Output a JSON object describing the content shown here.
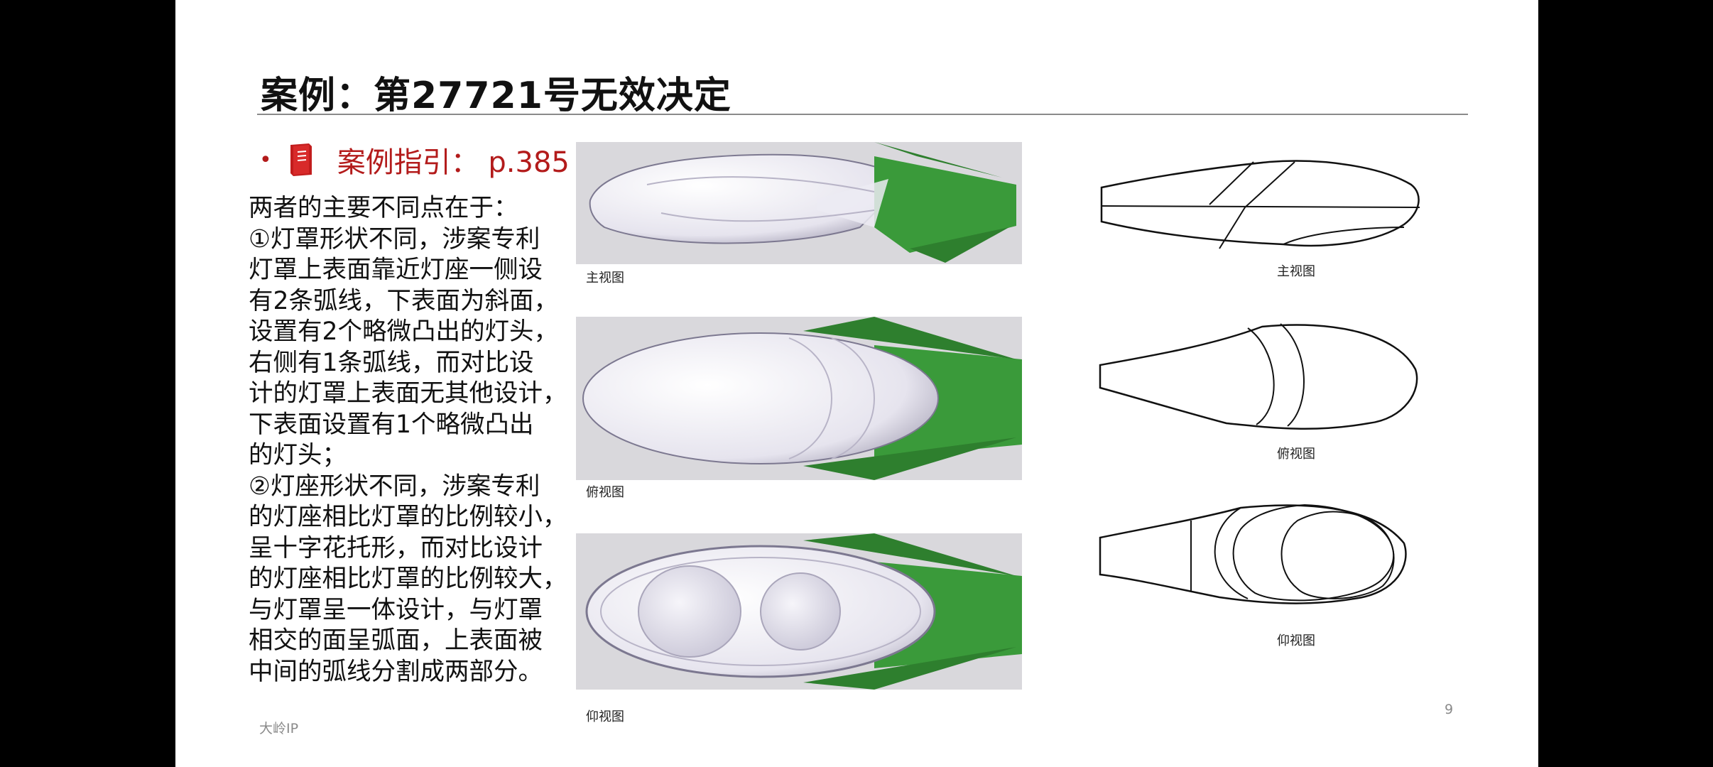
{
  "slide": {
    "title": "案例：第27721号无效决定",
    "guide": {
      "bullet": "•",
      "icon": "book-icon",
      "text": "案例指引： p.385",
      "color": "#b31b1b"
    },
    "body_lines": [
      "两者的主要不同点在于：",
      "①灯罩形状不同，涉案专利",
      "灯罩上表面靠近灯座一侧设",
      "有2条弧线，下表面为斜面，",
      "设置有2个略微凸出的灯头，",
      "右侧有1条弧线，而对比设",
      "计的灯罩上表面无其他设计，",
      "下表面设置有1个略微凸出",
      "的灯头；",
      "②灯座形状不同，涉案专利",
      "的灯座相比灯罩的比例较小，",
      "呈十字花托形，而对比设计",
      "的灯座相比灯罩的比例较大，",
      "与灯罩呈一体设计，与灯罩",
      "相交的面呈弧面，上表面被",
      "中间的弧线分割成两部分。"
    ],
    "patent_captions": [
      "主视图",
      "俯视图",
      "仰视图"
    ],
    "comparison_captions": [
      "主视图",
      "俯视图",
      "仰视图"
    ],
    "footer": "大岭IP",
    "page_number": "9",
    "colors": {
      "green_base": "#3a9a3a",
      "shell": "#ecebf3",
      "background": "#d9d8dc"
    }
  }
}
